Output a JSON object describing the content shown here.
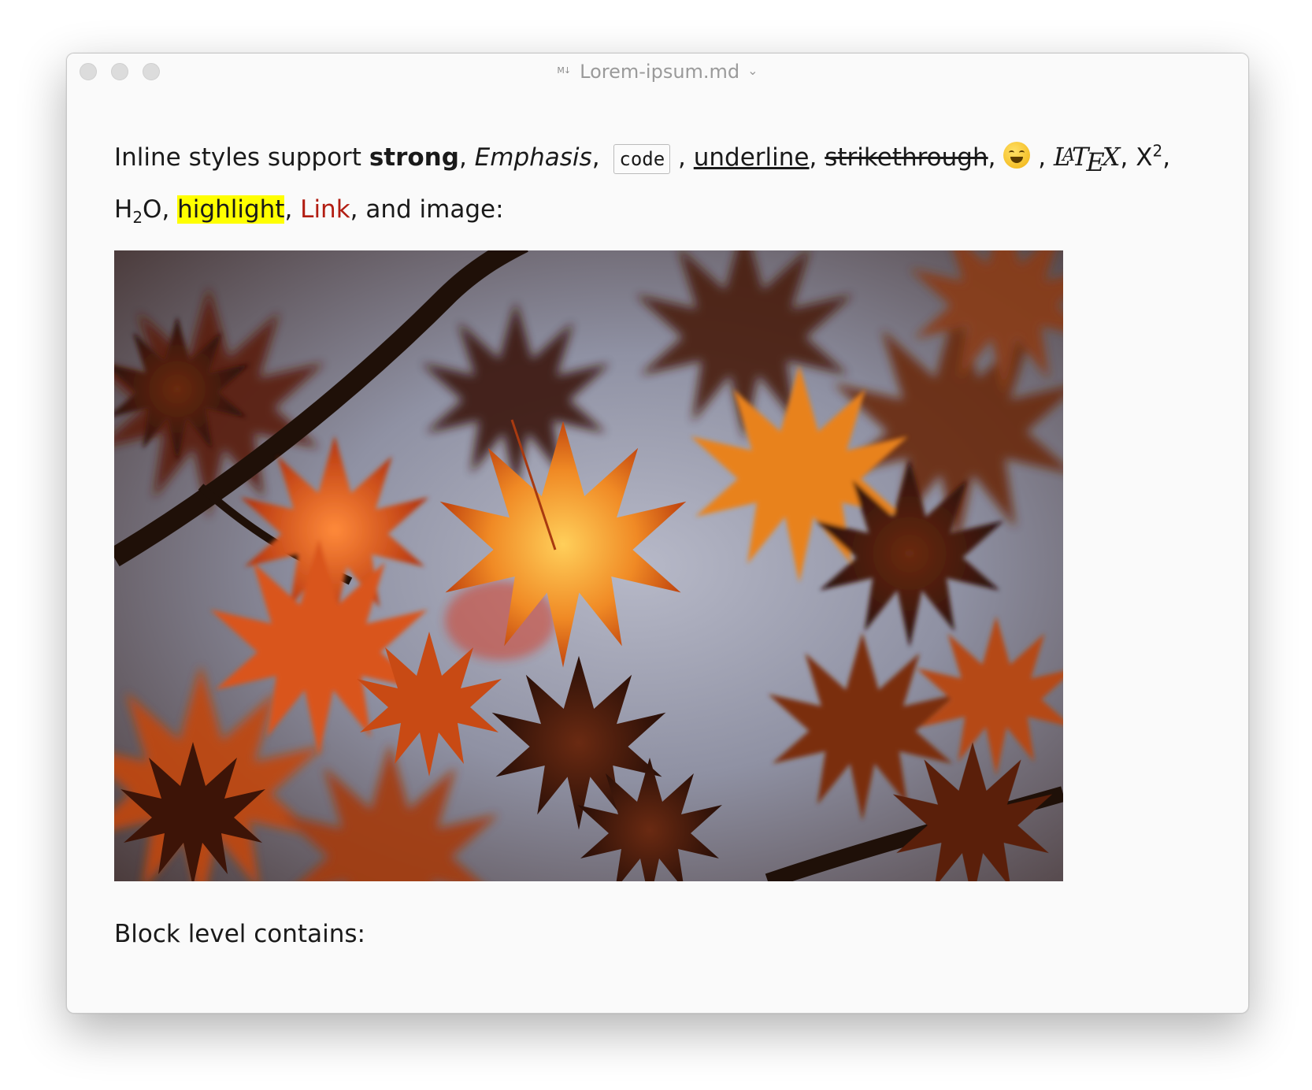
{
  "window": {
    "title": "Lorem-ipsum.md",
    "file_icon_label": "M↓",
    "chevron": "⌄"
  },
  "paragraph1": {
    "intro": "Inline styles support ",
    "strong": "strong",
    "sep1": ", ",
    "emphasis": "Emphasis",
    "sep2": ", ",
    "code": "code",
    "sep3": " , ",
    "underline": "underline",
    "sep4": ", ",
    "strikethrough": "strikethrough",
    "sep5": ", ",
    "sep6": " , ",
    "latex_l": "L",
    "latex_a": "A",
    "latex_t": "T",
    "latex_e": "E",
    "latex_x": "X",
    "sep7": ", X",
    "sup": "2",
    "sep8": ", H",
    "sub": "2",
    "sep9": "O, ",
    "highlight": "highlight",
    "sep10": ", ",
    "link": "Link",
    "outro": ", and image:"
  },
  "emoji": {
    "icon": "laughing-face"
  },
  "image": {
    "alt": ""
  },
  "block": {
    "text": "Block level contains:"
  }
}
